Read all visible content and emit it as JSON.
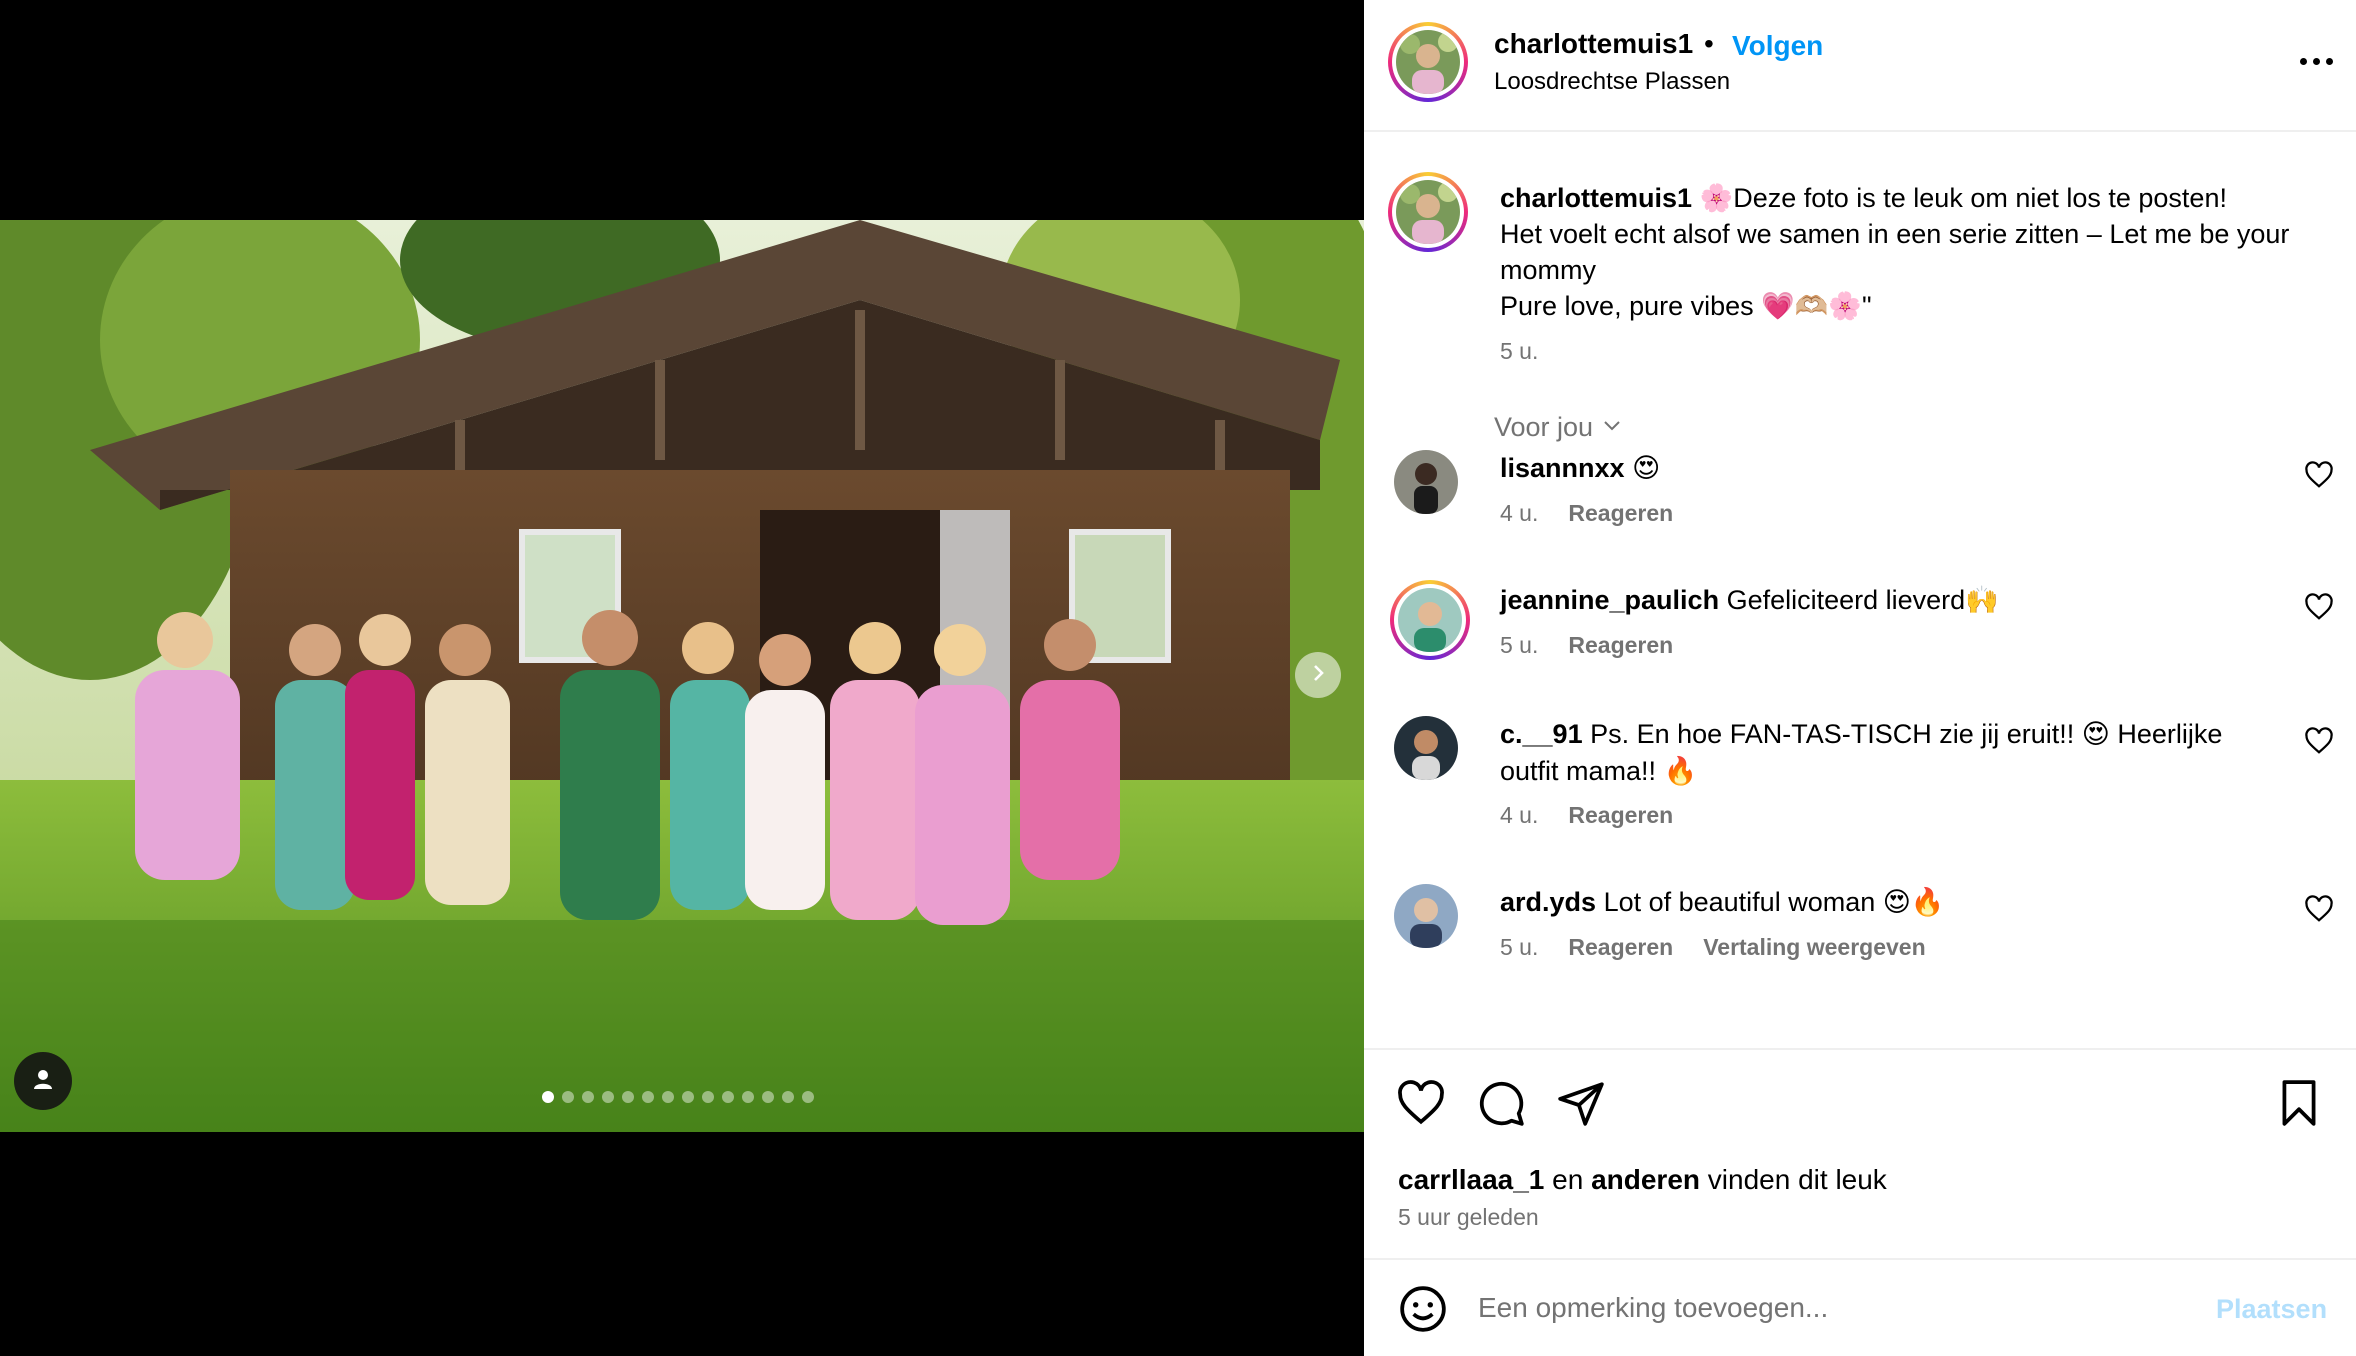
{
  "post": {
    "username": "charlottemuis1",
    "dot": "•",
    "follow_label": "Volgen",
    "location": "Loosdrechtse Plassen"
  },
  "caption": {
    "username": "charlottemuis1",
    "line1": "🌸Deze foto is te leuk om niet los te posten!",
    "line2": "Het voelt echt alsof we samen in een serie zitten – Let me be your mommy",
    "line3": "Pure love, pure vibes 💗🫶🏼🌸\"",
    "time": "5 u."
  },
  "for_you_label": "Voor jou",
  "comments": [
    {
      "username": "lisannnxx",
      "text": "😍",
      "time": "4 u.",
      "reply": "Reageren",
      "translate": ""
    },
    {
      "username": "jeannine_paulich",
      "text": "Gefeliciteerd lieverd🙌",
      "time": "5 u.",
      "reply": "Reageren",
      "translate": ""
    },
    {
      "username": "c.__91",
      "text": "Ps. En hoe FAN-TAS-TISCH zie jij eruit!! 😍 Heerlijke outfit mama!! 🔥",
      "time": "4 u.",
      "reply": "Reageren",
      "translate": ""
    },
    {
      "username": "ard.yds",
      "text": "Lot of beautiful woman 😍🔥",
      "time": "5 u.",
      "reply": "Reageren",
      "translate": "Vertaling weergeven"
    }
  ],
  "likes": {
    "user": "carrllaaa_1",
    "connector": "en",
    "others": "anderen",
    "suffix": "vinden dit leuk"
  },
  "posted_time": "5 uur geleden",
  "add_comment": {
    "placeholder": "Een opmerking toevoegen...",
    "post_label": "Plaatsen"
  },
  "carousel": {
    "count": 14,
    "active_index": 0
  },
  "colors": {
    "link_blue": "#0095f6",
    "post_disabled": "#b2dffc",
    "secondary_text": "#737373",
    "divider": "#efefef"
  },
  "icons": [
    "user-tag-icon",
    "chevron-right-icon",
    "more-icon",
    "heart-icon",
    "comment-icon",
    "share-icon",
    "bookmark-icon",
    "emoji-icon",
    "chevron-down-icon"
  ]
}
